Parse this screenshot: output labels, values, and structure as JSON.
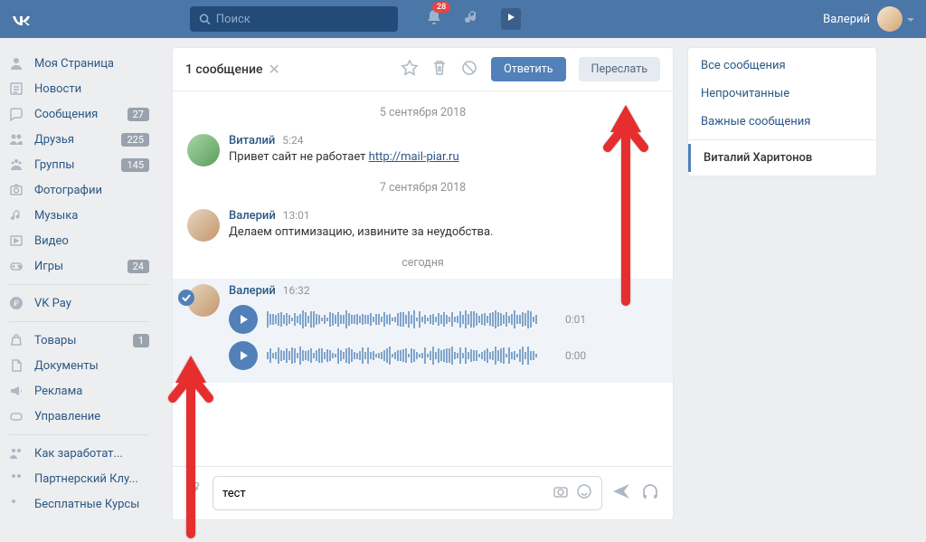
{
  "header": {
    "search_placeholder": "Поиск",
    "notif_count": "28",
    "user_name": "Валерий"
  },
  "sidebar": {
    "main": [
      {
        "label": "Моя Страница"
      },
      {
        "label": "Новости"
      },
      {
        "label": "Сообщения",
        "count": "27"
      },
      {
        "label": "Друзья",
        "count": "225"
      },
      {
        "label": "Группы",
        "count": "145"
      },
      {
        "label": "Фотографии"
      },
      {
        "label": "Музыка"
      },
      {
        "label": "Видео"
      },
      {
        "label": "Игры",
        "count": "24"
      }
    ],
    "pay": {
      "label": "VK Pay"
    },
    "extra": [
      {
        "label": "Товары",
        "count": "1"
      },
      {
        "label": "Документы"
      },
      {
        "label": "Реклама"
      },
      {
        "label": "Управление"
      }
    ],
    "promo": [
      {
        "label": "Как заработат..."
      },
      {
        "label": "Партнерский Клу..."
      },
      {
        "label": "Бесплатные Курсы"
      }
    ]
  },
  "chat": {
    "selection": "1 сообщение",
    "reply": "Ответить",
    "forward": "Переслать",
    "date1": "5 сентября 2018",
    "date2": "7 сентября 2018",
    "date3": "сегодня",
    "m1": {
      "name": "Виталий",
      "time": "5:24",
      "text": "Привет сайт не работает ",
      "link": "http://mail-piar.ru"
    },
    "m2": {
      "name": "Валерий",
      "time": "13:01",
      "text": "Делаем оптимизацию, извините за неудобства."
    },
    "m3": {
      "name": "Валерий",
      "time": "16:32",
      "v1": "0:01",
      "v2": "0:00"
    },
    "input_value": "тест"
  },
  "right": {
    "all": "Все сообщения",
    "unread": "Непрочитанные",
    "important": "Важные сообщения",
    "active": "Виталий Харитонов"
  }
}
